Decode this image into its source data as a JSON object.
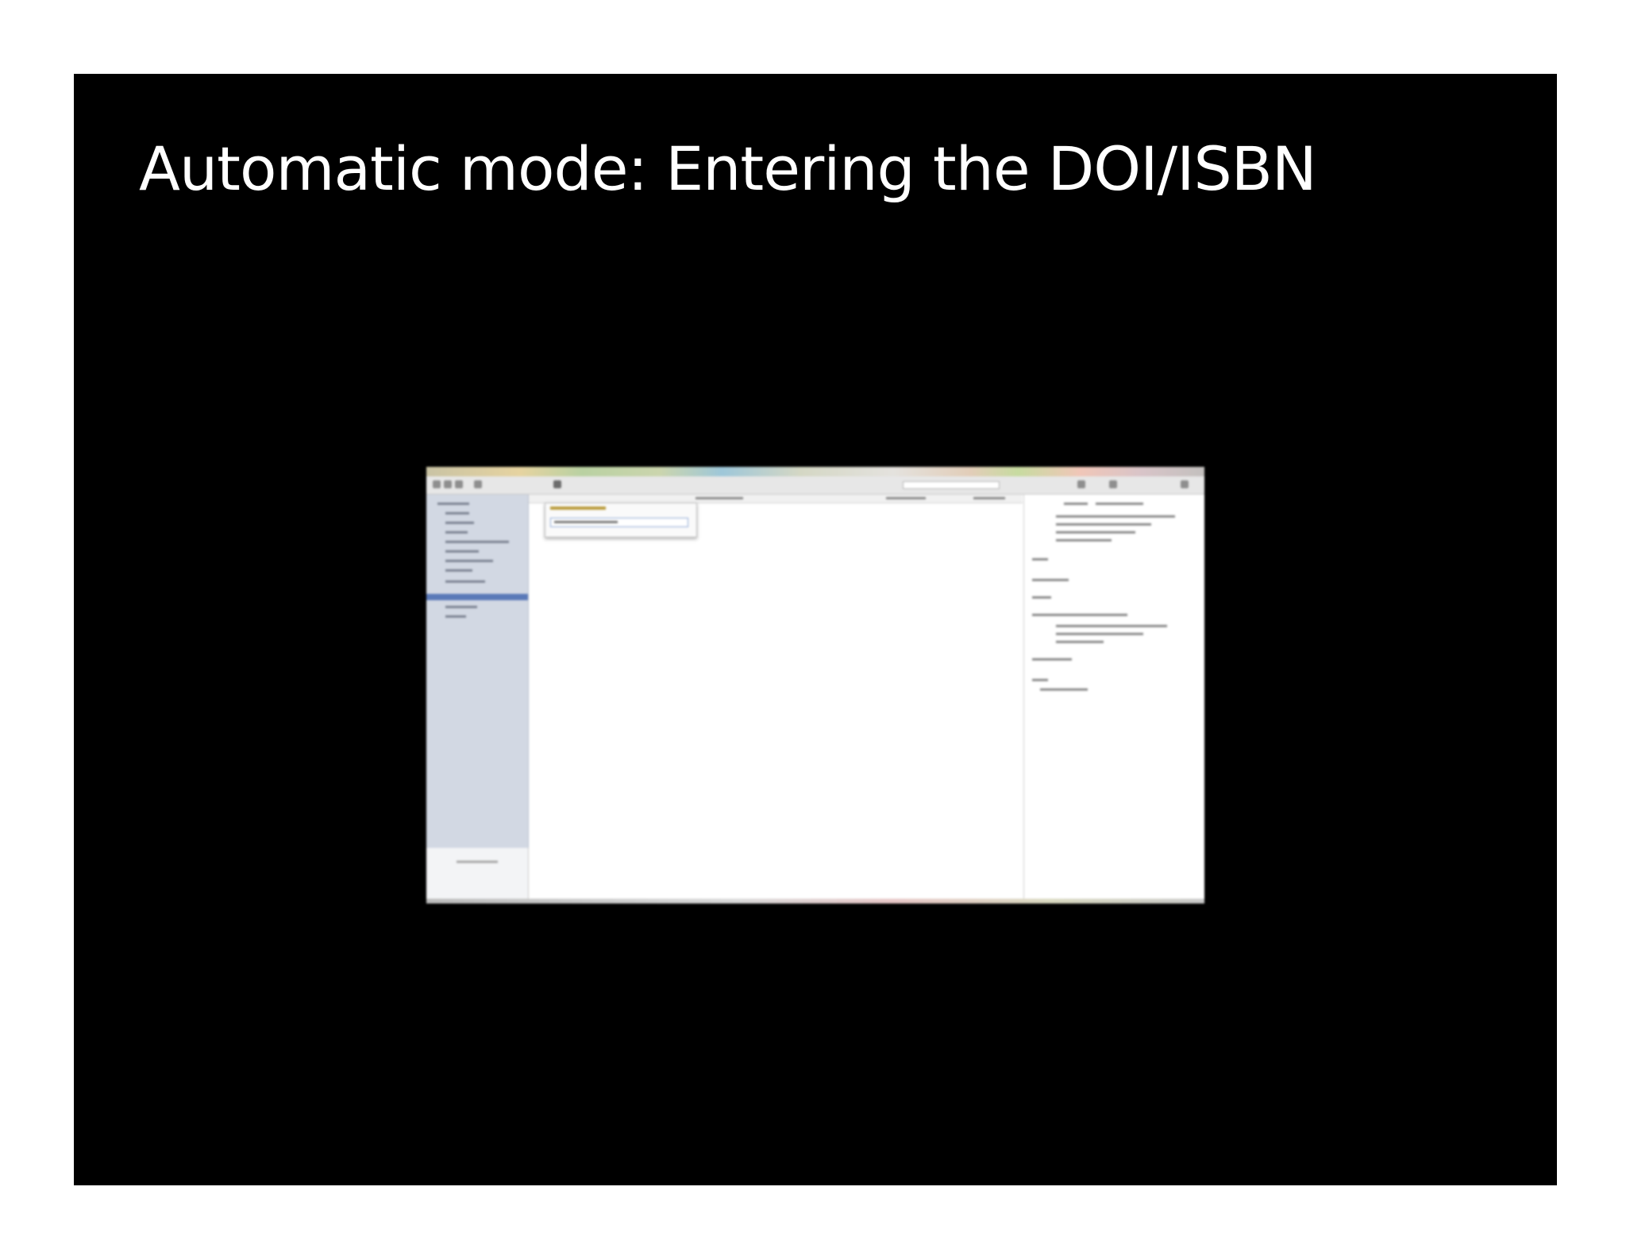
{
  "slide": {
    "title": "Automatic mode: Entering the DOI/ISBN"
  },
  "screenshot": {
    "description_visible": false,
    "colors": {
      "sidebar": "#d2d8e3",
      "selection": "#5a79b8",
      "slide_background": "#000000",
      "page_background": "#ffffff"
    },
    "icons": [
      "toolbar-button-icon",
      "lookup-magic-wand-icon"
    ]
  }
}
